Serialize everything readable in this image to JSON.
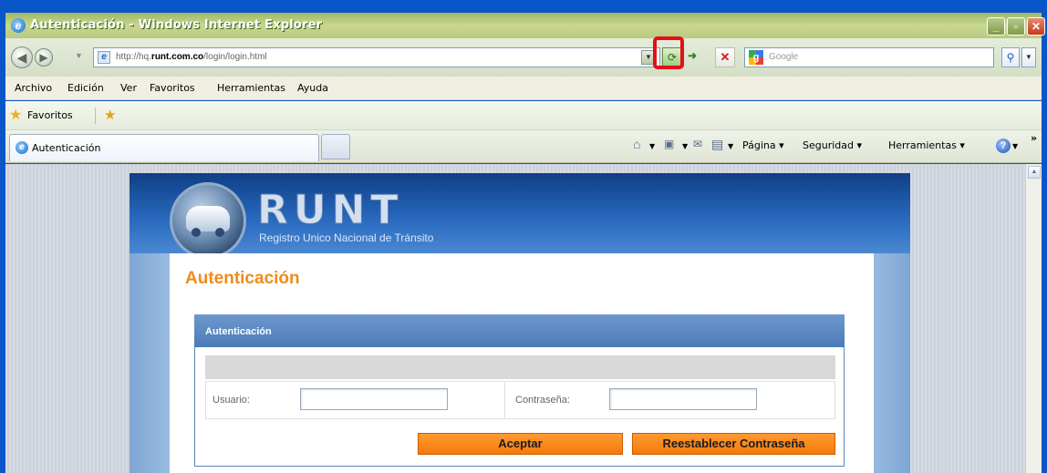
{
  "window": {
    "title": "Autenticación - Windows Internet Explorer"
  },
  "toolbar": {
    "url_prefix": "http://hq.",
    "url_domain": "runt.com.co",
    "url_path": "/login/login.html",
    "search_placeholder": "Google"
  },
  "menu": {
    "items": [
      "Archivo",
      "Edición",
      "Ver",
      "Favoritos",
      "Herramientas",
      "Ayuda"
    ]
  },
  "favorites": {
    "label": "Favoritos"
  },
  "tabs": {
    "active_label": "Autenticación"
  },
  "commands": {
    "page": "Página ▾",
    "security": "Seguridad ▾",
    "tools": "Herramientas ▾",
    "overflow": "»"
  },
  "site": {
    "logo_text": "RUNT",
    "logo_subtitle": "Registro Unico Nacional de Tránsito",
    "page_title": "Autenticación",
    "panel_title": "Autenticación",
    "user_label": "Usuario:",
    "password_label": "Contraseña:",
    "accept_label": "Aceptar",
    "reset_label": "Reestablecer Contraseña"
  },
  "icons": {
    "ie": "ie-logo-icon",
    "back": "back-arrow-icon",
    "forward": "forward-arrow-icon",
    "refresh": "refresh-icon",
    "stop": "stop-icon",
    "search": "search-icon",
    "favorites_star": "star-icon",
    "add_favorite": "add-favorite-icon",
    "home": "home-icon",
    "feeds": "feeds-icon",
    "mail": "mail-icon",
    "print": "print-icon",
    "help": "help-icon"
  },
  "colors": {
    "title_orange": "#ef8a1c",
    "button_orange": "#f57a0c",
    "highlight_red": "#e0101a",
    "header_blue": "#2a6bc0"
  }
}
